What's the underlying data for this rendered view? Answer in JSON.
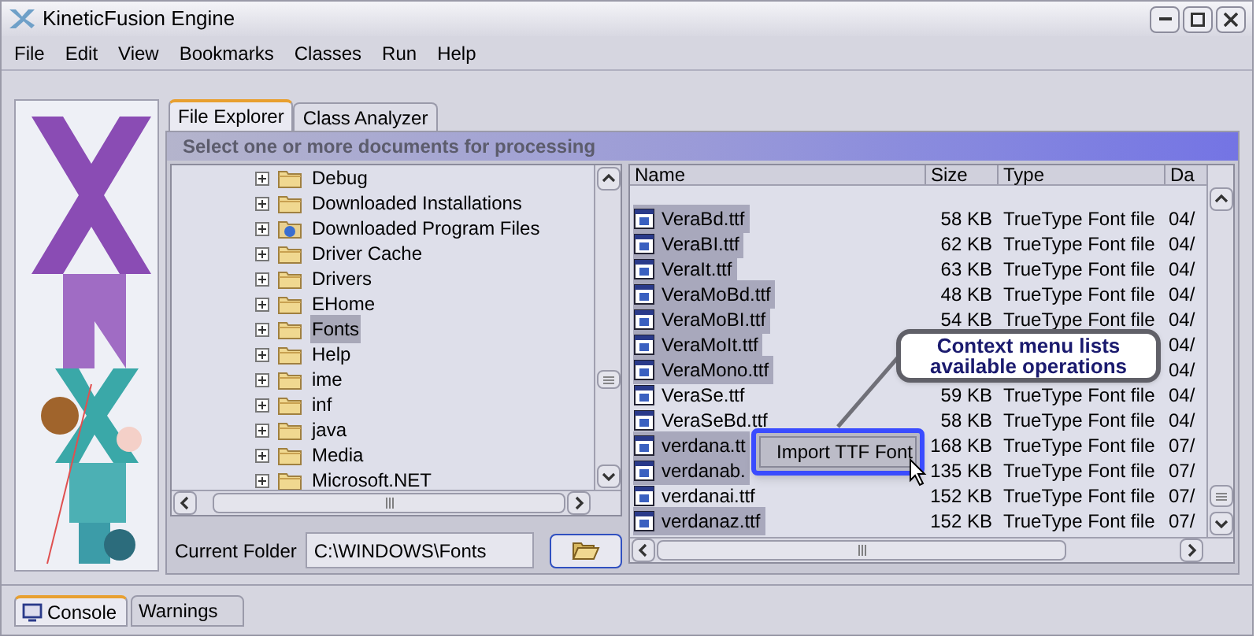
{
  "window": {
    "title": "KineticFusion Engine"
  },
  "menu": [
    "File",
    "Edit",
    "View",
    "Bookmarks",
    "Classes",
    "Run",
    "Help"
  ],
  "tabs": [
    {
      "label": "File Explorer",
      "selected": true
    },
    {
      "label": "Class Analyzer",
      "selected": false
    }
  ],
  "instruction": "Select one or more documents for processing",
  "tree": {
    "items": [
      {
        "label": "Debug",
        "kind": "folder",
        "selected": false
      },
      {
        "label": "Downloaded Installations",
        "kind": "folder",
        "selected": false
      },
      {
        "label": "Downloaded Program Files",
        "kind": "web-folder",
        "selected": false
      },
      {
        "label": "Driver Cache",
        "kind": "folder",
        "selected": false
      },
      {
        "label": "Drivers",
        "kind": "folder",
        "selected": false
      },
      {
        "label": "EHome",
        "kind": "folder",
        "selected": false
      },
      {
        "label": "Fonts",
        "kind": "folder",
        "selected": true
      },
      {
        "label": "Help",
        "kind": "folder",
        "selected": false
      },
      {
        "label": "ime",
        "kind": "folder",
        "selected": false
      },
      {
        "label": "inf",
        "kind": "folder",
        "selected": false
      },
      {
        "label": "java",
        "kind": "folder",
        "selected": false
      },
      {
        "label": "Media",
        "kind": "folder",
        "selected": false
      },
      {
        "label": "Microsoft.NET",
        "kind": "folder",
        "selected": false
      }
    ]
  },
  "current_folder": {
    "label": "Current Folder",
    "value": "C:\\WINDOWS\\Fonts"
  },
  "files": {
    "columns": [
      "Name",
      "Size",
      "Type",
      "Da"
    ],
    "rows": [
      {
        "name": "VeraBd.ttf",
        "size": "58 KB",
        "type": "TrueType Font file",
        "date": "04/",
        "selected": true
      },
      {
        "name": "VeraBI.ttf",
        "size": "62 KB",
        "type": "TrueType Font file",
        "date": "04/",
        "selected": true
      },
      {
        "name": "VeraIt.ttf",
        "size": "63 KB",
        "type": "TrueType Font file",
        "date": "04/",
        "selected": true
      },
      {
        "name": "VeraMoBd.ttf",
        "size": "48 KB",
        "type": "TrueType Font file",
        "date": "04/",
        "selected": true
      },
      {
        "name": "VeraMoBI.ttf",
        "size": "54 KB",
        "type": "TrueType Font file",
        "date": "04/",
        "selected": true
      },
      {
        "name": "VeraMoIt.ttf",
        "date": "04/",
        "selected": true
      },
      {
        "name": "VeraMono.ttf",
        "date": "04/",
        "selected": true
      },
      {
        "name": "VeraSe.ttf",
        "size": "59 KB",
        "type": "TrueType Font file",
        "date": "04/",
        "selected": false
      },
      {
        "name": "VeraSeBd.ttf",
        "size": "58 KB",
        "type": "TrueType Font file",
        "date": "04/",
        "selected": false
      },
      {
        "name": "verdana.tt",
        "size": "168 KB",
        "type": "TrueType Font file",
        "date": "07/",
        "selected": true
      },
      {
        "name": "verdanab.",
        "size": "135 KB",
        "type": "TrueType Font file",
        "date": "07/",
        "selected": true
      },
      {
        "name": "verdanai.ttf",
        "size": "152 KB",
        "type": "TrueType Font file",
        "date": "07/",
        "selected": false
      },
      {
        "name": "verdanaz.ttf",
        "size": "152 KB",
        "type": "TrueType Font file",
        "date": "07/",
        "selected": true
      }
    ]
  },
  "context_menu": [
    "Import TTF Font"
  ],
  "callout": "Context menu lists available operations",
  "bottom_tabs": [
    {
      "label": "Console",
      "selected": true
    },
    {
      "label": "Warnings",
      "selected": false
    }
  ]
}
